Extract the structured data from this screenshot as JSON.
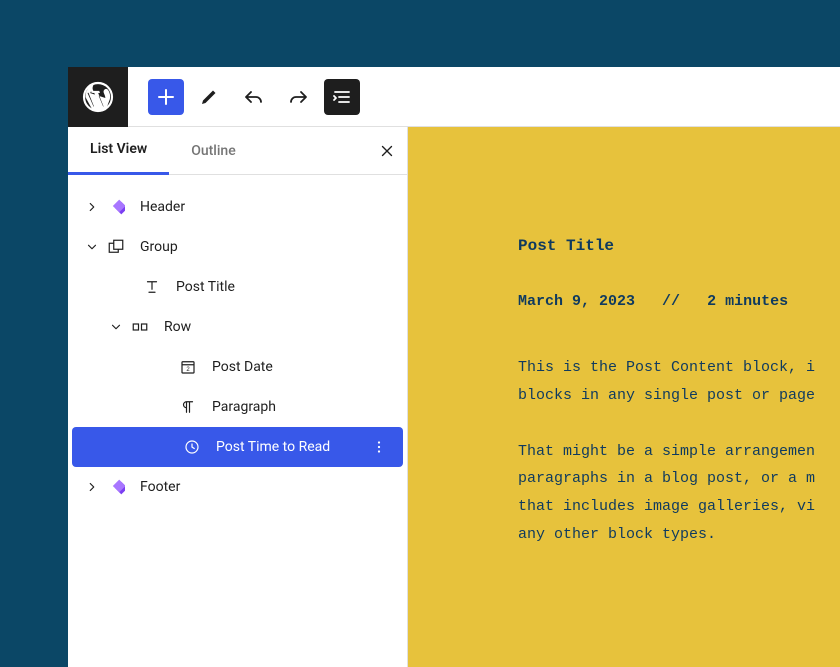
{
  "tabs": {
    "list_view": "List View",
    "outline": "Outline"
  },
  "tree": {
    "header": "Header",
    "group": "Group",
    "post_title": "Post Title",
    "row": "Row",
    "post_date": "Post Date",
    "paragraph": "Paragraph",
    "post_time_to_read": "Post Time to Read",
    "footer": "Footer"
  },
  "canvas": {
    "title": "Post Title",
    "date": "March 9, 2023",
    "separator": "//",
    "read_time": "2 minutes",
    "para1": "This is the Post Content block, i\nblocks in any single post or page",
    "para2": "That might be a simple arrangemen\nparagraphs in a blog post, or a m\nthat includes image galleries, vi\nany other block types."
  },
  "colors": {
    "accent": "#3858e9",
    "canvas_bg": "#e7c23c",
    "canvas_fg": "#0f3a5f",
    "site_bg": "#0b4766"
  }
}
